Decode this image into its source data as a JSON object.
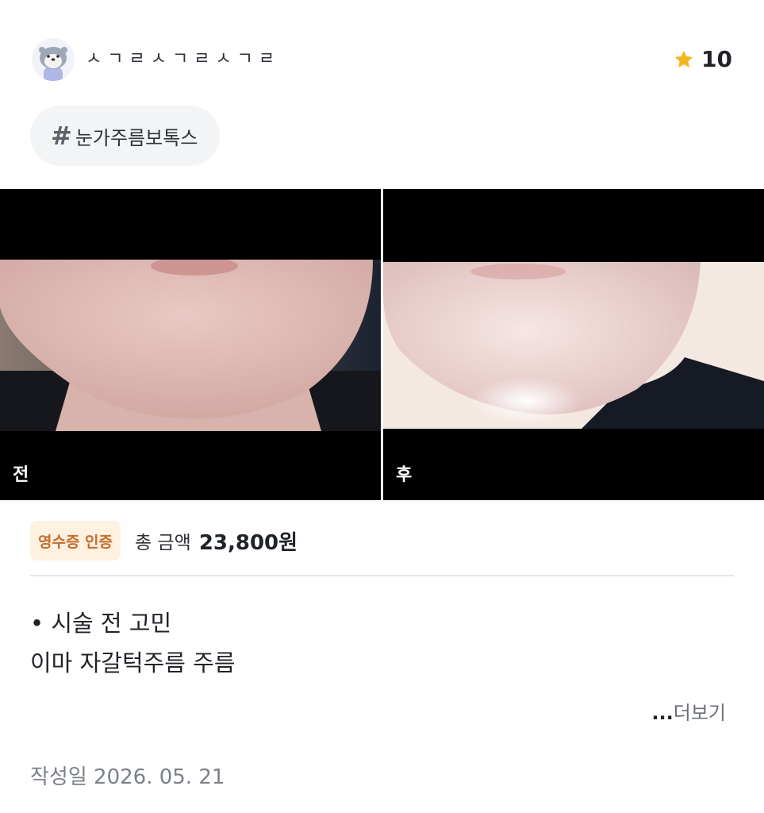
{
  "author": {
    "name": "ㅅㄱㄹㅅㄱㄹㅅㄱㄹ",
    "avatar_icon": "otter-avatar"
  },
  "rating": {
    "icon": "star-icon",
    "value": "10",
    "star_color": "#f5b51e"
  },
  "tag": {
    "hash": "#",
    "label": "눈가주름보톡스"
  },
  "photos": {
    "before_label": "전",
    "after_label": "후"
  },
  "receipt": {
    "badge": "영수증 인증",
    "total_label": "총 금액",
    "total_value": "23,800원"
  },
  "review": {
    "line1": "• 시술 전 고민",
    "line2": "이마 자갈턱주름 주름"
  },
  "more": {
    "dots": "...",
    "label": "더보기"
  },
  "date": "작성일 2026. 05. 21"
}
